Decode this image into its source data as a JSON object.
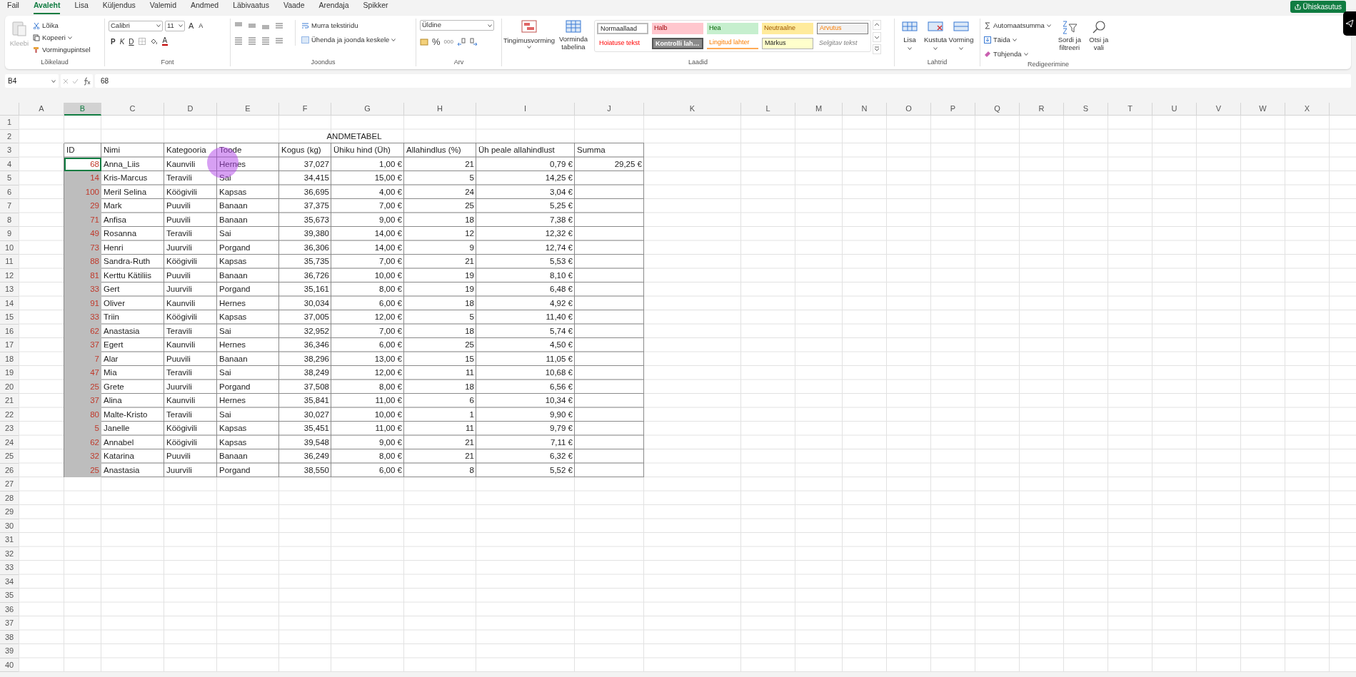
{
  "menu_tabs": [
    {
      "label": "Fail",
      "selected": false
    },
    {
      "label": "Avaleht",
      "selected": true
    },
    {
      "label": "Lisa",
      "selected": false
    },
    {
      "label": "Küljendus",
      "selected": false
    },
    {
      "label": "Valemid",
      "selected": false
    },
    {
      "label": "Andmed",
      "selected": false
    },
    {
      "label": "Läbivaatus",
      "selected": false
    },
    {
      "label": "Vaade",
      "selected": false
    },
    {
      "label": "Arendaja",
      "selected": false
    },
    {
      "label": "Spikker",
      "selected": false
    }
  ],
  "share_button": {
    "label": "Ühiskasutus"
  },
  "ribbon": {
    "clipboard": {
      "title": "Lõikelaud",
      "paste": "Kleebi",
      "items": [
        "Lõika",
        "Kopeeri",
        "Vormingupintsel"
      ]
    },
    "font": {
      "title": "Font",
      "font_name": "Calibri",
      "font_size": "11",
      "grow": "A",
      "shrink": "A",
      "bold": "P",
      "italic": "K",
      "underline": "D",
      "font_color": "A"
    },
    "alignment": {
      "title": "Joondus",
      "wrap": "Murra tekstiridu",
      "merge": "Ühenda ja joonda keskele"
    },
    "number": {
      "title": "Arv",
      "format": "Üldine",
      "percent": "%",
      "thousands": "000"
    },
    "styles": {
      "title": "Laadid",
      "conditional": "Tingimusvorming",
      "format_table": "Vorminda tabelina",
      "cells": [
        {
          "label": "Normaallaad",
          "kind": "normal"
        },
        {
          "label": "Halb",
          "kind": "bad"
        },
        {
          "label": "Hea",
          "kind": "good"
        },
        {
          "label": "Neutraalne",
          "kind": "neutral"
        },
        {
          "label": "Arvutus",
          "kind": "calculation"
        },
        {
          "label": "Hoiatuse tekst",
          "kind": "warning"
        },
        {
          "label": "Kontrolli lah…",
          "kind": "check"
        },
        {
          "label": "Lingitud lahter",
          "kind": "linked"
        },
        {
          "label": "Märkus",
          "kind": "note"
        },
        {
          "label": "Selgitav tekst",
          "kind": "explanatory"
        }
      ]
    },
    "cells": {
      "title": "Lahtrid",
      "buttons": [
        "Lisa",
        "Kustuta",
        "Vorming"
      ]
    },
    "editing": {
      "title": "Redigeerimine",
      "autosum": "Automaatsumma",
      "fill": "Täida",
      "clear": "Tühjenda",
      "sort": "Sordi ja filtreeri",
      "find": "Otsi ja vali"
    }
  },
  "formula_bar": {
    "name_box": "B4",
    "formula": "68"
  },
  "sheet": {
    "columns": [
      {
        "label": "A",
        "selected": false
      },
      {
        "label": "B",
        "selected": true
      },
      {
        "label": "C",
        "selected": false
      },
      {
        "label": "D",
        "selected": false
      },
      {
        "label": "E",
        "selected": false
      },
      {
        "label": "F",
        "selected": false
      },
      {
        "label": "G",
        "selected": false
      },
      {
        "label": "H",
        "selected": false
      },
      {
        "label": "I",
        "selected": false
      },
      {
        "label": "J",
        "selected": false
      },
      {
        "label": "K",
        "selected": false
      },
      {
        "label": "L",
        "selected": false
      },
      {
        "label": "M",
        "selected": false
      },
      {
        "label": "N",
        "selected": false
      },
      {
        "label": "O",
        "selected": false
      },
      {
        "label": "P",
        "selected": false
      },
      {
        "label": "Q",
        "selected": false
      },
      {
        "label": "R",
        "selected": false
      },
      {
        "label": "S",
        "selected": false
      },
      {
        "label": "T",
        "selected": false
      },
      {
        "label": "U",
        "selected": false
      },
      {
        "label": "V",
        "selected": false
      },
      {
        "label": "W",
        "selected": false
      },
      {
        "label": "X",
        "selected": false
      }
    ],
    "row_numbers": [
      "1",
      "2",
      "3",
      "4",
      "5",
      "6",
      "7",
      "8",
      "9",
      "10",
      "11",
      "12",
      "13",
      "14",
      "15",
      "16",
      "17",
      "18",
      "19",
      "20",
      "21",
      "22",
      "23",
      "24",
      "25",
      "26",
      "27",
      "28",
      "29",
      "30",
      "31",
      "32",
      "33",
      "34",
      "35",
      "36",
      "37",
      "38",
      "39",
      "40"
    ],
    "title": "ANDMETABEL",
    "table": {
      "columns": [
        "ID",
        "Nimi",
        "Kategooria",
        "Toode",
        "Kogus (kg)",
        "Ühiku hind (Üh)",
        "Allahindlus (%)",
        "Üh peale allahindlust",
        "Summa"
      ],
      "rows": [
        {
          "id": "68",
          "name": "Anna_Liis",
          "category": "Kaunvili",
          "product": "Hernes",
          "quantity": "37,027",
          "unit_price": "1,00 €",
          "discount": "21",
          "discounted_price": "0,79 €",
          "sum": "29,25 €",
          "active": true
        },
        {
          "id": "14",
          "name": "Kris-Marcus",
          "category": "Teravili",
          "product": "Sai",
          "quantity": "34,415",
          "unit_price": "15,00 €",
          "discount": "5",
          "discounted_price": "14,25 €",
          "active": false
        },
        {
          "id": "100",
          "name": "Meril Selina",
          "category": "Köögivili",
          "product": "Kapsas",
          "quantity": "36,695",
          "unit_price": "4,00 €",
          "discount": "24",
          "discounted_price": "3,04 €",
          "active": false
        },
        {
          "id": "29",
          "name": "Mark",
          "category": "Puuvili",
          "product": "Banaan",
          "quantity": "37,375",
          "unit_price": "7,00 €",
          "discount": "25",
          "discounted_price": "5,25 €",
          "active": false
        },
        {
          "id": "71",
          "name": "Anfisa",
          "category": "Puuvili",
          "product": "Banaan",
          "quantity": "35,673",
          "unit_price": "9,00 €",
          "discount": "18",
          "discounted_price": "7,38 €",
          "active": false
        },
        {
          "id": "49",
          "name": "Rosanna",
          "category": "Teravili",
          "product": "Sai",
          "quantity": "39,380",
          "unit_price": "14,00 €",
          "discount": "12",
          "discounted_price": "12,32 €",
          "active": false
        },
        {
          "id": "73",
          "name": "Henri",
          "category": "Juurvili",
          "product": "Porgand",
          "quantity": "36,306",
          "unit_price": "14,00 €",
          "discount": "9",
          "discounted_price": "12,74 €",
          "active": false
        },
        {
          "id": "88",
          "name": "Sandra-Ruth",
          "category": "Köögivili",
          "product": "Kapsas",
          "quantity": "35,735",
          "unit_price": "7,00 €",
          "discount": "21",
          "discounted_price": "5,53 €",
          "active": false
        },
        {
          "id": "81",
          "name": "Kerttu Kätiliis",
          "category": "Puuvili",
          "product": "Banaan",
          "quantity": "36,726",
          "unit_price": "10,00 €",
          "discount": "19",
          "discounted_price": "8,10 €",
          "active": false
        },
        {
          "id": "33",
          "name": "Gert",
          "category": "Juurvili",
          "product": "Porgand",
          "quantity": "35,161",
          "unit_price": "8,00 €",
          "discount": "19",
          "discounted_price": "6,48 €",
          "active": false
        },
        {
          "id": "91",
          "name": "Oliver",
          "category": "Kaunvili",
          "product": "Hernes",
          "quantity": "30,034",
          "unit_price": "6,00 €",
          "discount": "18",
          "discounted_price": "4,92 €",
          "active": false
        },
        {
          "id": "33",
          "name": "Triin",
          "category": "Köögivili",
          "product": "Kapsas",
          "quantity": "37,005",
          "unit_price": "12,00 €",
          "discount": "5",
          "discounted_price": "11,40 €",
          "active": false
        },
        {
          "id": "62",
          "name": "Anastasia",
          "category": "Teravili",
          "product": "Sai",
          "quantity": "32,952",
          "unit_price": "7,00 €",
          "discount": "18",
          "discounted_price": "5,74 €",
          "active": false
        },
        {
          "id": "37",
          "name": "Egert",
          "category": "Kaunvili",
          "product": "Hernes",
          "quantity": "36,346",
          "unit_price": "6,00 €",
          "discount": "25",
          "discounted_price": "4,50 €",
          "active": false
        },
        {
          "id": "7",
          "name": "Alar",
          "category": "Puuvili",
          "product": "Banaan",
          "quantity": "38,296",
          "unit_price": "13,00 €",
          "discount": "15",
          "discounted_price": "11,05 €",
          "active": false
        },
        {
          "id": "47",
          "name": "Mia",
          "category": "Teravili",
          "product": "Sai",
          "quantity": "38,249",
          "unit_price": "12,00 €",
          "discount": "11",
          "discounted_price": "10,68 €",
          "active": false
        },
        {
          "id": "25",
          "name": "Grete",
          "category": "Juurvili",
          "product": "Porgand",
          "quantity": "37,508",
          "unit_price": "8,00 €",
          "discount": "18",
          "discounted_price": "6,56 €",
          "active": false
        },
        {
          "id": "37",
          "name": "Alina",
          "category": "Kaunvili",
          "product": "Hernes",
          "quantity": "35,841",
          "unit_price": "11,00 €",
          "discount": "6",
          "discounted_price": "10,34 €",
          "active": false
        },
        {
          "id": "80",
          "name": "Malte-Kristo",
          "category": "Teravili",
          "product": "Sai",
          "quantity": "30,027",
          "unit_price": "10,00 €",
          "discount": "1",
          "discounted_price": "9,90 €",
          "active": false
        },
        {
          "id": "5",
          "name": "Janelle",
          "category": "Köögivili",
          "product": "Kapsas",
          "quantity": "35,451",
          "unit_price": "11,00 €",
          "discount": "11",
          "discounted_price": "9,79 €",
          "active": false
        },
        {
          "id": "62",
          "name": "Annabel",
          "category": "Köögivili",
          "product": "Kapsas",
          "quantity": "39,548",
          "unit_price": "9,00 €",
          "discount": "21",
          "discounted_price": "7,11 €",
          "active": false
        },
        {
          "id": "32",
          "name": "Katarina",
          "category": "Puuvili",
          "product": "Banaan",
          "quantity": "36,249",
          "unit_price": "8,00 €",
          "discount": "21",
          "discounted_price": "6,32 €",
          "active": false
        },
        {
          "id": "25",
          "name": "Anastasia",
          "category": "Juurvili",
          "product": "Porgand",
          "quantity": "38,550",
          "unit_price": "6,00 €",
          "discount": "8",
          "discounted_price": "5,52 €",
          "active": false
        }
      ]
    }
  }
}
